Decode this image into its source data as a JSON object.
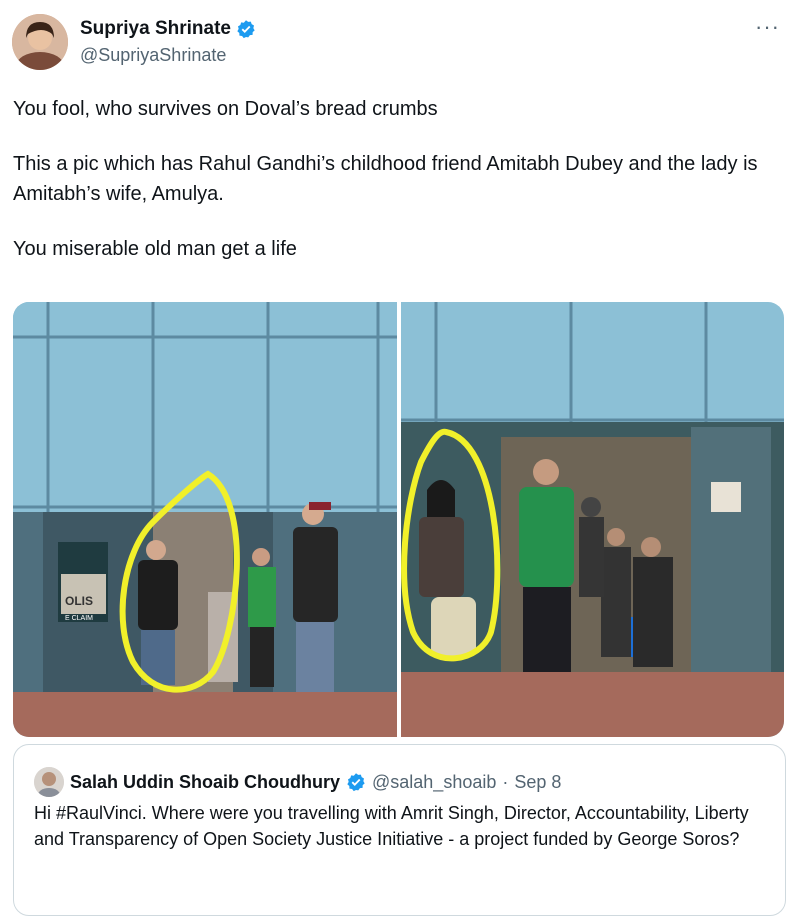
{
  "author": {
    "display_name": "Supriya Shrinate",
    "handle": "@SupriyaShrinate",
    "verified_icon": "verified-badge-icon",
    "more_icon": "more-options-icon",
    "more_label": "···"
  },
  "tweet": {
    "lines": [
      "You fool, who survives on Doval’s bread crumbs",
      "This a pic which has Rahul Gandhi’s childhood friend Amitabh Dubey and the lady is Amitabh’s wife, Amulya.",
      "You miserable old man get a life"
    ]
  },
  "media": {
    "left_sign_text_1": "OLIS",
    "left_sign_text_2": "E CLAIM",
    "highlight_color": "#f1f02a"
  },
  "quote": {
    "display_name": "Salah Uddin Shoaib Choudhury",
    "handle": "@salah_shoaib",
    "separator": "·",
    "date": "Sep 8",
    "text": "Hi #RaulVinci. Where were you travelling with Amrit Singh, Director, Accountability, Liberty and Transparency of Open Society Justice Initiative - a project funded by George Soros?"
  },
  "colors": {
    "accent": "#1d9bf0",
    "muted": "#536471",
    "border": "#cfd9de"
  }
}
